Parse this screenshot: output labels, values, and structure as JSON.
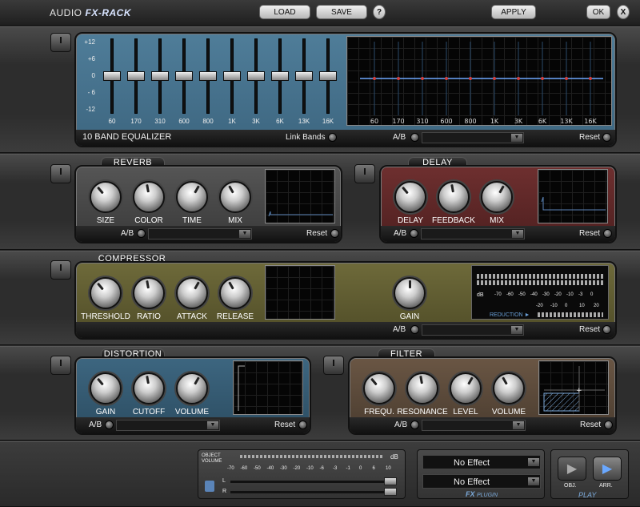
{
  "app": {
    "title_prefix": "AUDIO",
    "title_brand": "FX-RACK"
  },
  "toolbar": {
    "load": "LOAD",
    "save": "SAVE",
    "help": "?",
    "apply": "APPLY",
    "ok": "OK",
    "close": "X"
  },
  "equalizer": {
    "title": "10 BAND EQUALIZER",
    "link_bands": "Link Bands",
    "ab": "A/B",
    "reset": "Reset",
    "scale": [
      "+12",
      "+6",
      "0",
      "- 6",
      "-12"
    ],
    "bands": [
      "60",
      "170",
      "310",
      "600",
      "800",
      "1K",
      "3K",
      "6K",
      "13K",
      "16K"
    ],
    "gains_db": [
      0,
      0,
      0,
      0,
      0,
      0,
      0,
      0,
      0,
      0
    ]
  },
  "reverb": {
    "title": "REVERB",
    "knobs": [
      "SIZE",
      "COLOR",
      "TIME",
      "MIX"
    ],
    "ab": "A/B",
    "reset": "Reset"
  },
  "delay": {
    "title": "DELAY",
    "knobs": [
      "DELAY",
      "FEEDBACK",
      "MIX"
    ],
    "ab": "A/B",
    "reset": "Reset"
  },
  "compressor": {
    "title": "COMPRESSOR",
    "knobs": [
      "THRESHOLD",
      "RATIO",
      "ATTACK",
      "RELEASE"
    ],
    "gain": "GAIN",
    "ab": "A/B",
    "reset": "Reset",
    "meter_db_label": "dB",
    "meter_top_scale": [
      "-70",
      "-60",
      "-50",
      "-40",
      "-30",
      "-20",
      "-10",
      "-3",
      "0"
    ],
    "meter_bottom_scale": [
      "-20",
      "-10",
      "0",
      "10",
      "20"
    ],
    "reduction_label": "REDUCTION ►"
  },
  "distortion": {
    "title": "DISTORTION",
    "knobs": [
      "GAIN",
      "CUTOFF",
      "VOLUME"
    ],
    "ab": "A/B",
    "reset": "Reset"
  },
  "filter": {
    "title": "FILTER",
    "knobs": [
      "FREQU.",
      "RESONANCE",
      "LEVEL",
      "VOLUME"
    ],
    "ab": "A/B",
    "reset": "Reset"
  },
  "footer": {
    "object_volume": "OBJECT",
    "object_volume2": "VOLUME",
    "db": "dB",
    "scale": [
      "-70",
      "-60",
      "-50",
      "-40",
      "-30",
      "-20",
      "-10",
      "-6",
      "-3",
      "-1",
      "0",
      "6",
      "10"
    ],
    "ch_l": "L",
    "ch_r": "R",
    "plugin_slot1": "No Effect",
    "plugin_slot2": "No Effect",
    "fx_plugin_fx": "FX",
    "fx_plugin": "PLUGIN",
    "obj": "OBJ.",
    "arr": "ARR.",
    "play": "PLAY"
  }
}
